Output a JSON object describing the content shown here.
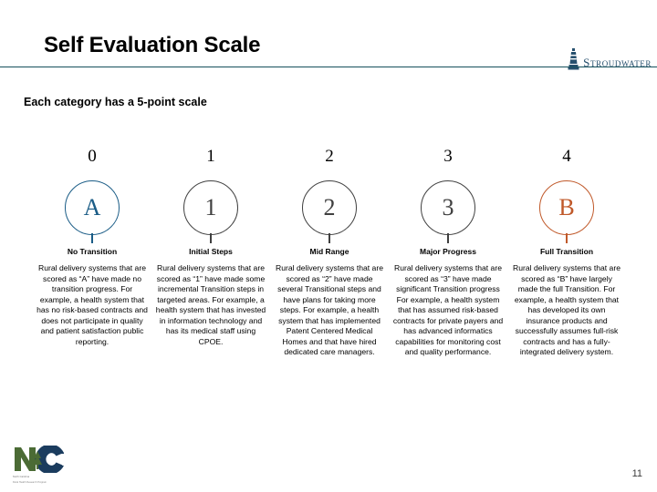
{
  "header": {
    "title": "Self Evaluation Scale",
    "brand_name": "Stroudwater",
    "brand_icon": "lighthouse-icon",
    "rule_color": "#15505c",
    "brand_color": "#27506e"
  },
  "subtitle": "Each category has a 5-point scale",
  "colors": {
    "accent_blue": "#1a5c86",
    "accent_orange": "#c0592a",
    "neutral_gray": "#404040"
  },
  "scale": {
    "columns": [
      {
        "number": "0",
        "badge": "A",
        "accent": "accent-blue",
        "label": "No Transition",
        "description": "Rural delivery systems that are scored as “A” have made no transition progress.  For example, a health system that has no risk-based contracts and does not participate in quality and patient satisfaction public reporting."
      },
      {
        "number": "1",
        "badge": "1",
        "accent": "neutral",
        "label": "Initial Steps",
        "description": "Rural delivery systems that are scored as “1” have made some incremental Transition steps in targeted areas. For example, a health system that has invested in information technology and has its medical staff using CPOE."
      },
      {
        "number": "2",
        "badge": "2",
        "accent": "neutral",
        "label": "Mid Range",
        "description": "Rural delivery systems that are scored as “2” have made several Transitional steps and have plans for taking more steps.  For example, a health system  that has implemented Patent Centered Medical Homes and that have hired dedicated care managers."
      },
      {
        "number": "3",
        "badge": "3",
        "accent": "neutral",
        "label": "Major Progress",
        "description": "Rural delivery systems that are scored as “3” have made significant Transition progress For example, a health system  that has assumed risk-based contracts for private payers and has advanced informatics capabilities for monitoring cost and quality performance."
      },
      {
        "number": "4",
        "badge": "B",
        "accent": "accent-orange",
        "label": "Full Transition",
        "description": "Rural delivery systems that are scored as “B” have largely made the full Transition.  For example, a health system that has developed its own insurance products and successfully assumes full-risk contracts and has a fully-integrated delivery system."
      }
    ]
  },
  "footer": {
    "logo_text": "NC",
    "logo_icon": "pine-tree-icon",
    "logo_caption_line1": "North Carolina",
    "logo_caption_line2": "Rural Health Research Program",
    "page_number": "11"
  }
}
